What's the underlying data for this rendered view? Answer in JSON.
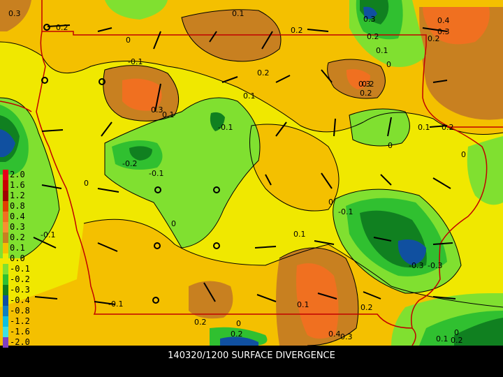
{
  "caption": "140320/1200 SURFACE DIVERGENCE",
  "legend": [
    {
      "label": "2.0",
      "color": "#e8001a"
    },
    {
      "label": "1.6",
      "color": "#c80000"
    },
    {
      "label": "1.2",
      "color": "#a00000"
    },
    {
      "label": "0.8",
      "color": "#e04000"
    },
    {
      "label": "0.4",
      "color": "#f07020"
    },
    {
      "label": "0.3",
      "color": "#f89030"
    },
    {
      "label": "0.2",
      "color": "#c88020"
    },
    {
      "label": "0.1",
      "color": "#f4c000"
    },
    {
      "label": "0.0",
      "color": "#f0e800"
    },
    {
      "label": "-0.1",
      "color": "#80e030"
    },
    {
      "label": "-0.2",
      "color": "#30c030"
    },
    {
      "label": "-0.3",
      "color": "#108020"
    },
    {
      "label": "-0.4",
      "color": "#1050a0"
    },
    {
      "label": "-0.8",
      "color": "#1080c0"
    },
    {
      "label": "-1.2",
      "color": "#10c0e0"
    },
    {
      "label": "-1.6",
      "color": "#40e0e0"
    },
    {
      "label": "-2.0",
      "color": "#8040c0"
    }
  ],
  "contour_labels": [
    "0.3",
    "0.2",
    "0.1",
    "0",
    "0.2",
    "0.3",
    "0.2",
    "0.1",
    "0.4",
    "0.3",
    "0.2",
    "-0.1",
    "0",
    "0.1",
    "0.3",
    "0.2",
    "0.2",
    "0.3",
    "0.1",
    "0.2",
    "0.1",
    "0",
    "-0.1",
    "0.2",
    "-0.2",
    "-0.1",
    "0",
    "0",
    "0",
    "-0.1",
    "0.1",
    "0",
    "-0.1",
    "-0.3",
    "-0.3",
    "-0.1",
    "0.1",
    "0.2",
    "0.2",
    "0",
    "0.4",
    "0.3",
    "0.2",
    "0.1",
    "0",
    "0.2"
  ],
  "colors": {
    "background": "#000000",
    "caption": "#ffffff",
    "state_border": "#c00000",
    "contour": "#000000"
  }
}
